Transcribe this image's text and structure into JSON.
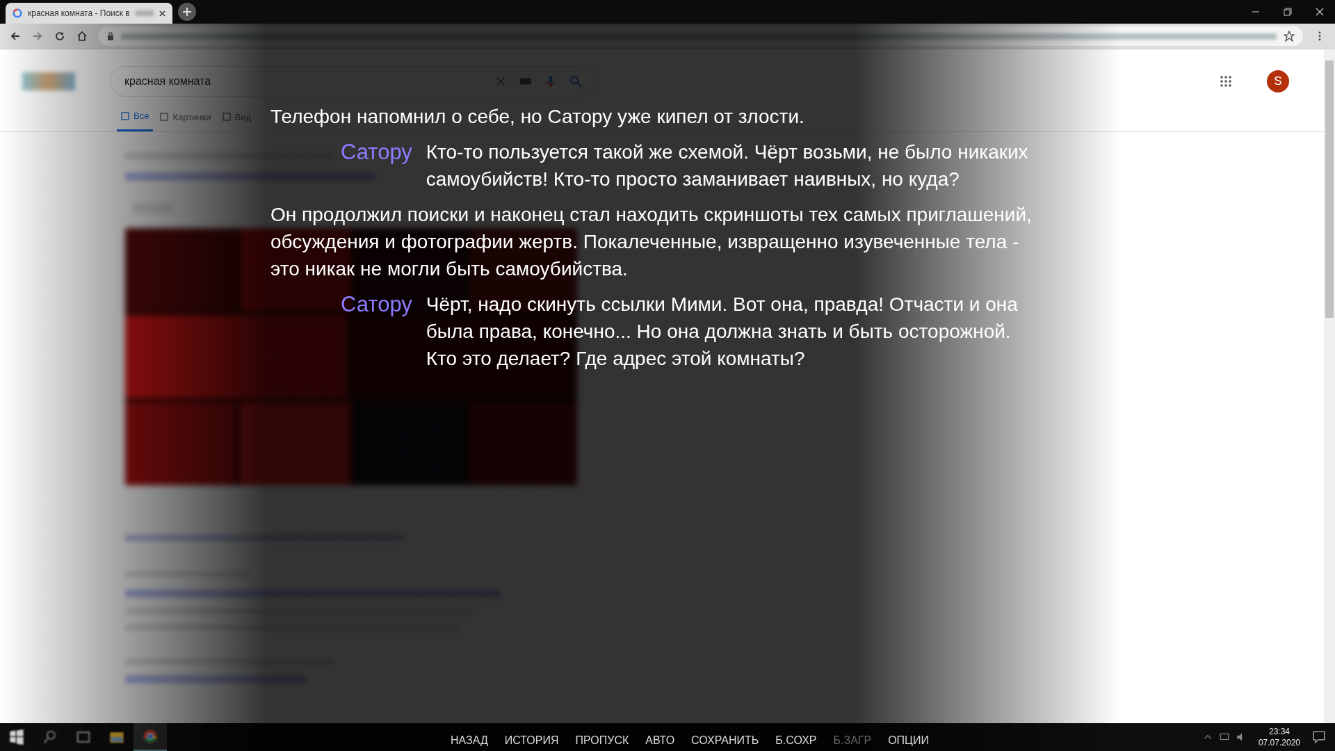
{
  "browser": {
    "tab": {
      "title": "красная комната - Поиск в",
      "selected": true
    },
    "search": {
      "value": "красная комната"
    },
    "search_tabs": [
      {
        "label": "Все",
        "selected": true
      },
      {
        "label": "Картинки",
        "selected": false
      },
      {
        "label": "Вид",
        "selected": false
      }
    ],
    "avatar": "S"
  },
  "dialogue": [
    {
      "kind": "narration",
      "text": "Телефон напомнил о себе, но Сатору уже кипел от злости."
    },
    {
      "kind": "speech",
      "speaker": "Сатору",
      "text": "Кто-то пользуется такой же схемой. Чёрт возьми, не было никаких самоубийств! Кто-то просто заманивает наивных, но куда?"
    },
    {
      "kind": "narration",
      "text": "Он продолжил поиски и наконец стал находить скриншоты тех самых приглашений, обсуждения и фотографии жертв. Покалеченные, извращенно изувеченные тела - это никак не могли быть самоубийства."
    },
    {
      "kind": "speech",
      "speaker": "Сатору",
      "text": "Чёрт, надо скинуть ссылки Мими. Вот она, правда! Отчасти и она была права, конечно... Но она должна знать и быть осторожной. Кто это делает? Где адрес этой комнаты?"
    }
  ],
  "quick_menu": [
    {
      "label": "НАЗАД",
      "disabled": false
    },
    {
      "label": "ИСТОРИЯ",
      "disabled": false
    },
    {
      "label": "ПРОПУСК",
      "disabled": false
    },
    {
      "label": "АВТО",
      "disabled": false
    },
    {
      "label": "СОХРАНИТЬ",
      "disabled": false
    },
    {
      "label": "Б.СОХР",
      "disabled": false
    },
    {
      "label": "Б.ЗАГР",
      "disabled": true
    },
    {
      "label": "ОПЦИИ",
      "disabled": false
    }
  ],
  "taskbar": {
    "time": "23:34",
    "date": "07.07.2020"
  }
}
